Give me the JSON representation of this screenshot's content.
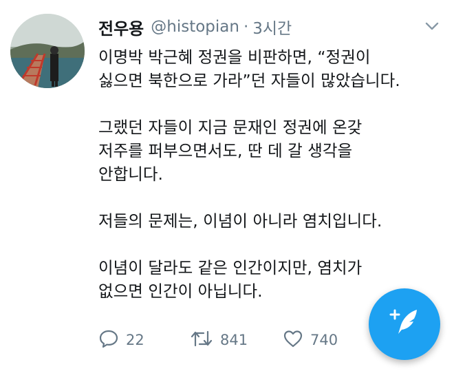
{
  "tweet": {
    "author_name": "전우용",
    "handle": "@histopian",
    "separator": "·",
    "time": "3시간",
    "paragraphs": [
      [
        "이명박 박근혜 정권을 비판하면, “정권이",
        "싫으면 북한으로 가라”던 자들이 많았습니다."
      ],
      [
        "그랬던 자들이 지금 문재인 정권에 온갖",
        "저주를 퍼부으면서도, 딴 데 갈 생각을",
        "안합니다."
      ],
      [
        "저들의 문제는, 이념이 아니라 염치입니다."
      ],
      [
        "이념이 달라도 같은 인간이지만, 염치가",
        "없으면 인간이 아닙니다."
      ]
    ]
  },
  "actions": {
    "reply_count": "22",
    "retweet_count": "841",
    "like_count": "740"
  },
  "icons": {
    "menu": "chevron-down-icon",
    "reply": "reply-icon",
    "retweet": "retweet-icon",
    "like": "heart-icon",
    "compose": "compose-feather-icon"
  },
  "colors": {
    "accent": "#1da1f2",
    "muted": "#657786",
    "text": "#14171a"
  }
}
